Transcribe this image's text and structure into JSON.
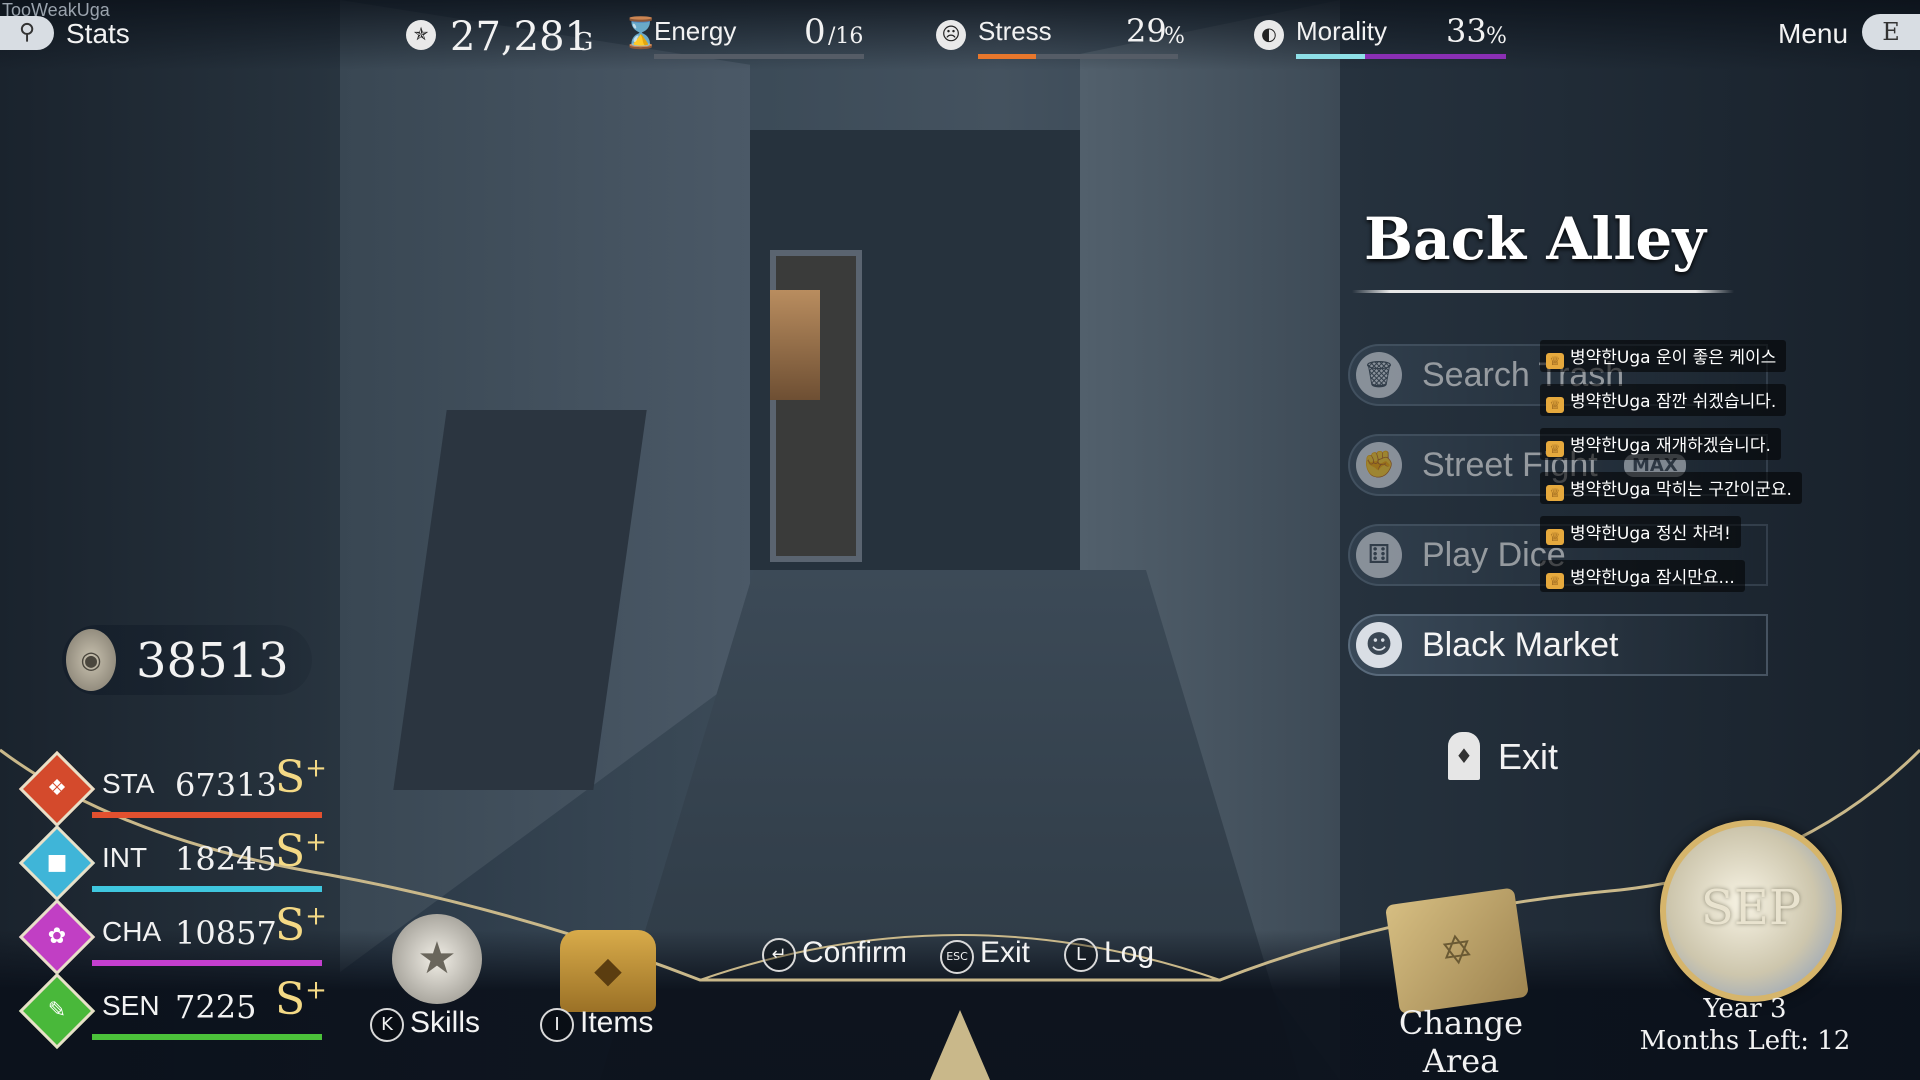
{
  "watermark": "TooWeakUga",
  "topbar": {
    "stats_label": "Stats",
    "gold_value": "27,281",
    "gold_unit": "G",
    "energy_label": "Energy",
    "energy_value": "0",
    "energy_max": "/16",
    "energy_level": 0.0,
    "stress_label": "Stress",
    "stress_value": "29",
    "stress_unit": "%",
    "stress_level": 0.29,
    "morality_label": "Morality",
    "morality_value": "33",
    "morality_unit": "%",
    "morality_level": 0.33,
    "menu_label": "Menu",
    "menu_key": "E",
    "stats_key_icon": "search-icon"
  },
  "location": {
    "title": "Back Alley",
    "actions": [
      {
        "label": "Search Trash",
        "icon": "trash-can-icon",
        "enabled": false
      },
      {
        "label": "Street Fight",
        "icon": "fire-fist-icon",
        "badge": "MAX",
        "enabled": false
      },
      {
        "label": "Play Dice",
        "icon": "dice-icon",
        "enabled": false
      },
      {
        "label": "Black Market",
        "icon": "mask-icon",
        "enabled": true
      }
    ],
    "exit_label": "Exit"
  },
  "chat_messages": [
    "병약한Uga 운이 좋은 케이스",
    "병약한Uga 잠깐 쉬겠습니다.",
    "병약한Uga 재개하겠습니다.",
    "병약한Uga 막히는 구간이군요.",
    "병약한Uga 정신 차려!",
    "병약한Uga 잠시만요..."
  ],
  "coins": "38513",
  "stats": [
    {
      "name": "STA",
      "value": "67313",
      "grade": "S",
      "plus": "+",
      "color": "#e2502f"
    },
    {
      "name": "INT",
      "value": "18245",
      "grade": "S",
      "plus": "+",
      "color": "#3fc7df"
    },
    {
      "name": "CHA",
      "value": "10857",
      "grade": "S",
      "plus": "+",
      "color": "#c43fcf"
    },
    {
      "name": "SEN",
      "value": "7225",
      "grade": "S",
      "plus": "+",
      "color": "#4bc23a"
    }
  ],
  "bottom": {
    "skills_key": "K",
    "skills_label": "Skills",
    "items_key": "I",
    "items_label": "Items",
    "confirm_label": "Confirm",
    "exit_key": "ESC",
    "exit_label": "Exit",
    "log_key": "L",
    "log_label": "Log",
    "change_area_label": "Change Area",
    "month_badge": "SEP",
    "year_label": "Year 3",
    "months_left_label": "Months Left: 12"
  }
}
